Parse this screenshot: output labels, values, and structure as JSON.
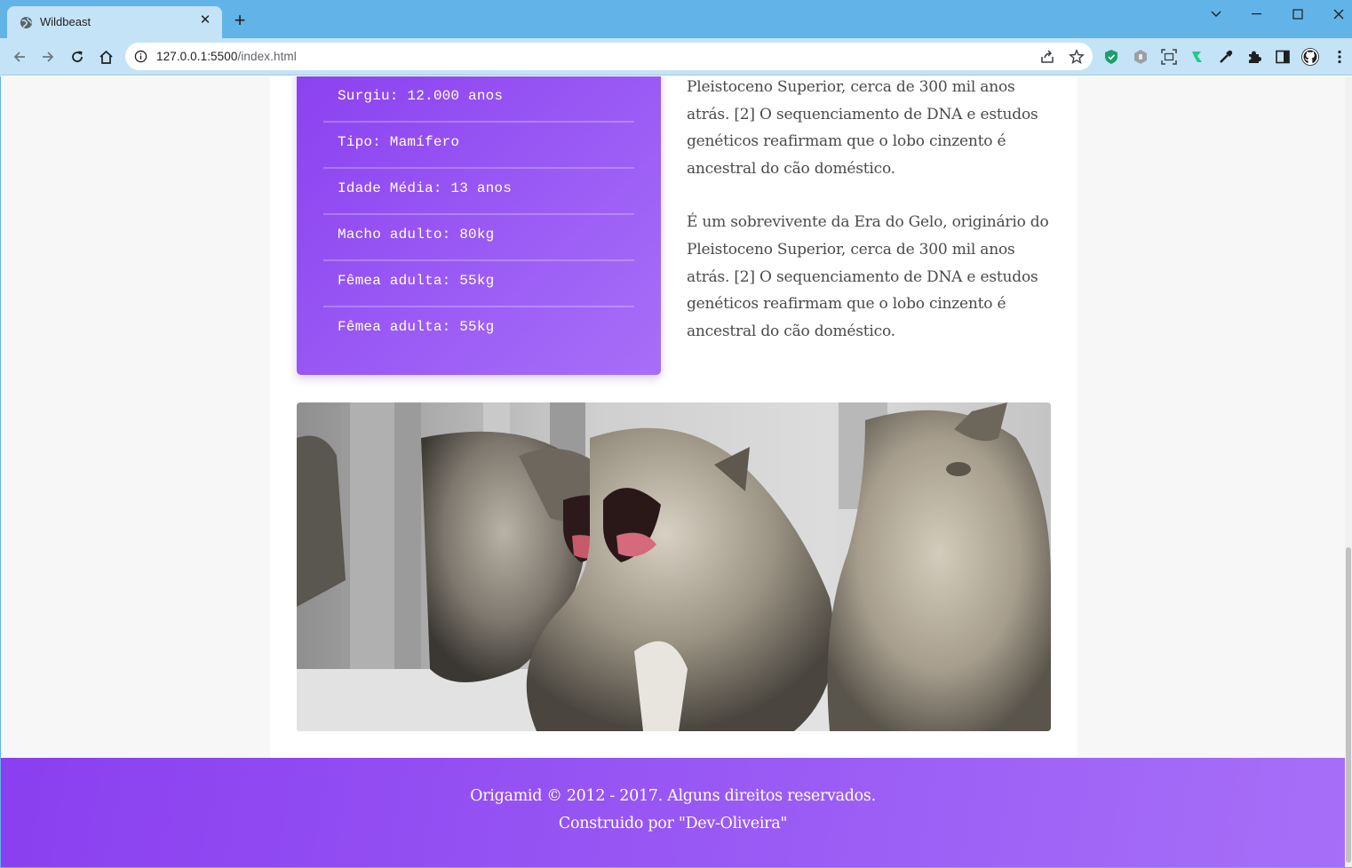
{
  "browser": {
    "tab_title": "Wildbeast",
    "tab_close": "✕",
    "new_tab": "+",
    "url_host": "127.0.0.1:5500",
    "url_path": "/index.html",
    "icons": [
      "back-arrow-icon",
      "forward-arrow-icon",
      "reload-icon",
      "home-icon",
      "info-icon",
      "share-icon",
      "bookmark-star-icon",
      "shield-extension-icon",
      "privacy-extension-icon",
      "screenshot-extension-icon",
      "tracker-extension-icon",
      "eyedropper-extension-icon",
      "extensions-puzzle-icon",
      "side-panel-icon",
      "profile-avatar-icon",
      "menu-kebab-icon"
    ]
  },
  "facts": {
    "items": [
      "Surgiu: 12.000 anos",
      "Tipo: Mamífero",
      "Idade Média: 13 anos",
      "Macho adulto: 80kg",
      "Fêmea adulta: 55kg",
      "Fêmea adulta: 55kg"
    ],
    "gradient_start": "#8a3ff0",
    "gradient_end": "#a76ff8"
  },
  "article": {
    "paragraph1": "Pleistoceno Superior, cerca de 300 mil anos atrás. [2] O sequenciamento de DNA e estudos genéticos reafirmam que o lobo cinzento é ancestral do cão doméstico.",
    "paragraph2": "É um sobrevivente da Era do Gelo, originário do Pleistoceno Superior, cerca de 300 mil anos atrás. [2] O sequenciamento de DNA e estudos genéticos reafirmam que o lobo cinzento é ancestral do cão doméstico."
  },
  "footer": {
    "line1": "Origamid © 2012 - 2017. Alguns direitos reservados.",
    "line2": "Construido por \"Dev-Oliveira\""
  }
}
